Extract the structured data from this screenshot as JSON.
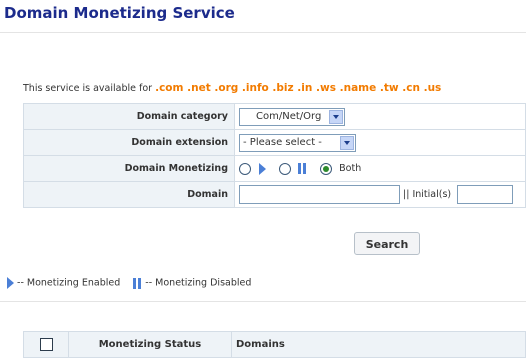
{
  "page_title": "Domain Monetizing Service",
  "availability": {
    "prefix": "This service is available for",
    "tlds": ".com .net .org .info .biz .in .ws .name .tw .cn .us"
  },
  "form": {
    "category": {
      "label": "Domain category",
      "selected": "Com/Net/Org"
    },
    "extension": {
      "label": "Domain extension",
      "selected": "- Please select -"
    },
    "monetizing": {
      "label": "Domain Monetizing",
      "both_label": "Both",
      "selected": "both"
    },
    "domain": {
      "label": "Domain",
      "initials_label": "|| Initial(s)"
    }
  },
  "search_button": "Search",
  "legend": {
    "enabled": "-- Monetizing Enabled",
    "disabled": "-- Monetizing Disabled"
  },
  "results_table": {
    "columns": [
      "Monetizing Status",
      "Domains"
    ]
  },
  "colors": {
    "title": "#1c2b8c",
    "tld_accent": "#f27b00",
    "label_bg": "#eef3f7",
    "icon_blue": "#4b7fd6"
  }
}
